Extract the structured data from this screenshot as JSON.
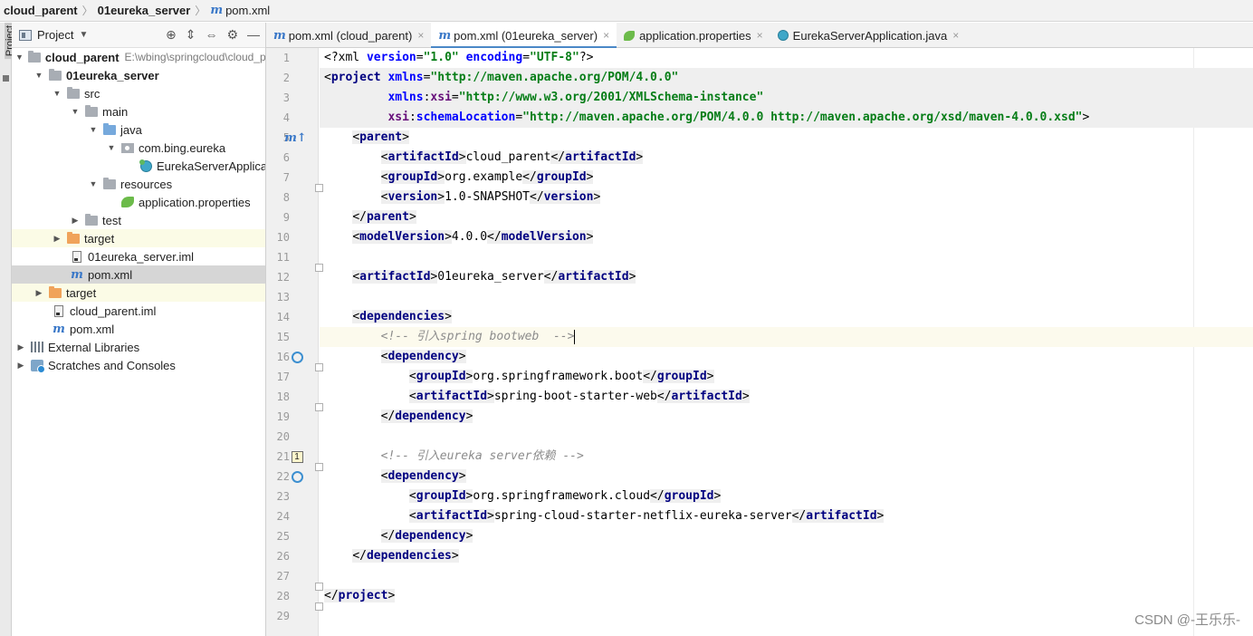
{
  "breadcrumb": {
    "project": "cloud_parent",
    "module": "01eureka_server",
    "file": "pom.xml",
    "file_icon": "m"
  },
  "side_strip": {
    "label": "Project"
  },
  "panel": {
    "title": "Project",
    "tools": [
      "⊕",
      "⇕",
      "⇔",
      "⚙",
      "—"
    ],
    "tree": [
      {
        "label": "cloud_parent",
        "hint": "E:\\wbing\\springcloud\\cloud_parent",
        "arrow": "▼",
        "icon": "folder"
      },
      {
        "label": "01eureka_server",
        "arrow": "▼",
        "icon": "folder"
      },
      {
        "label": "src",
        "arrow": "▼",
        "icon": "folder"
      },
      {
        "label": "main",
        "arrow": "▼",
        "icon": "folder"
      },
      {
        "label": "java",
        "arrow": "▼",
        "icon": "folder-blue"
      },
      {
        "label": "com.bing.eureka",
        "arrow": "▼",
        "icon": "package"
      },
      {
        "label": "EurekaServerApplication",
        "arrow": "",
        "icon": "class"
      },
      {
        "label": "resources",
        "arrow": "▼",
        "icon": "folder"
      },
      {
        "label": "application.properties",
        "arrow": "",
        "icon": "leaf"
      },
      {
        "label": "test",
        "arrow": "▶",
        "icon": "folder"
      },
      {
        "label": "target",
        "arrow": "▶",
        "icon": "folder-orange"
      },
      {
        "label": "01eureka_server.iml",
        "arrow": "",
        "icon": "file"
      },
      {
        "label": "pom.xml",
        "arrow": "",
        "icon": "m"
      },
      {
        "label": "target",
        "arrow": "▶",
        "icon": "folder-orange"
      },
      {
        "label": "cloud_parent.iml",
        "arrow": "",
        "icon": "file"
      },
      {
        "label": "pom.xml",
        "arrow": "",
        "icon": "m"
      },
      {
        "label": "External Libraries",
        "arrow": "▶",
        "icon": "libraries"
      },
      {
        "label": "Scratches and Consoles",
        "arrow": "▶",
        "icon": "scratches"
      }
    ]
  },
  "tabs": [
    {
      "label": "pom.xml (cloud_parent)",
      "icon": "m",
      "close": "×"
    },
    {
      "label": "pom.xml (01eureka_server)",
      "icon": "m",
      "close": "×"
    },
    {
      "label": "application.properties",
      "icon": "leaf",
      "close": "×"
    },
    {
      "label": "EurekaServerApplication.java",
      "icon": "class",
      "close": "×"
    }
  ],
  "editor": {
    "line_numbers": [
      "1",
      "2",
      "3",
      "4",
      "5",
      "6",
      "7",
      "8",
      "9",
      "10",
      "11",
      "12",
      "13",
      "14",
      "15",
      "16",
      "17",
      "18",
      "19",
      "20",
      "21",
      "22",
      "23",
      "24",
      "25",
      "26",
      "27",
      "28",
      "29"
    ],
    "gutter_marks": {
      "line5": "m↑",
      "line21": "1"
    },
    "code": {
      "l1_decl": "<?xml",
      "l1_version": "version",
      "l1_version_val": "\"1.0\"",
      "l1_enc": "encoding",
      "l1_enc_val": "\"UTF-8\"",
      "l2_project": "project",
      "l2_xmlns": "xmlns",
      "l2_xmlns_val": "\"http://maven.apache.org/POM/4.0.0\"",
      "l3_xsi": "xsi",
      "l3_xsi_val": "\"http://www.w3.org/2001/XMLSchema-instance\"",
      "l4_schema": "schemaLocation",
      "l4_schema_val": "\"http://maven.apache.org/POM/4.0.0 http://maven.apache.org/xsd/maven-4.0.0.xsd\"",
      "parent": "parent",
      "artifactId": "artifactId",
      "groupId": "groupId",
      "version": "version",
      "modelVersion": "modelVersion",
      "dependencies": "dependencies",
      "dependency": "dependency",
      "v_cloud_parent": "cloud_parent",
      "v_org_example": "org.example",
      "v_snapshot": "1.0-SNAPSHOT",
      "v_model": "4.0.0",
      "v_artifact": "01eureka_server",
      "comment1": "<!-- 引入spring bootweb  -->",
      "v_boot_group": "org.springframework.boot",
      "v_boot_artifact": "spring-boot-starter-web",
      "comment2": "<!-- 引入eureka server依赖 -->",
      "v_cloud_group": "org.springframework.cloud",
      "v_cloud_artifact": "spring-cloud-starter-netflix-eureka-server",
      "project_close": "project"
    }
  },
  "watermark": "CSDN @-王乐乐-"
}
